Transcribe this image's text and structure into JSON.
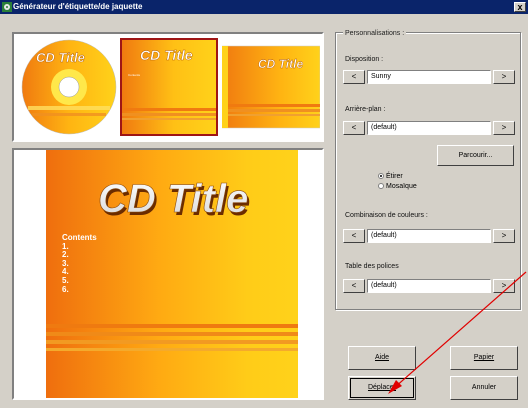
{
  "window": {
    "title": "Générateur d'étiquette/de jaquette",
    "close_glyph": "x"
  },
  "thumbnails": [
    {
      "title": "CD Title",
      "kind": "disc"
    },
    {
      "title": "CD Title",
      "kind": "front-cover",
      "selected": true
    },
    {
      "title": "CD Title",
      "kind": "back-cover"
    }
  ],
  "preview": {
    "title": "CD Title",
    "contents_heading": "Contents",
    "contents_items": [
      "1.",
      "2.",
      "3.",
      "4.",
      "5.",
      "6."
    ]
  },
  "panel": {
    "group_label": "Personnalisations :",
    "layout_label": "Disposition :",
    "layout_value": "Sunny",
    "background_label": "Arrière-plan :",
    "background_value": "(default)",
    "browse_button": "Parcourir...",
    "stretch_option": "Étirer",
    "tile_option": "Mosaïque",
    "stretch_selected": true,
    "color_label": "Combinaison de couleurs :",
    "color_value": "(default)",
    "font_label": "Table des polices",
    "font_value": "(default)",
    "prev_glyph": "<",
    "next_glyph": ">"
  },
  "buttons": {
    "help": "Aide",
    "paper": "Papier",
    "move": "Déplacer",
    "cancel": "Annuler"
  },
  "colors": {
    "titlebar": "#0a246a",
    "dialog": "#d4d0c8",
    "cover_orange": "#f07a10",
    "cover_yellow": "#ffd21a",
    "arrow": "#e00000"
  }
}
